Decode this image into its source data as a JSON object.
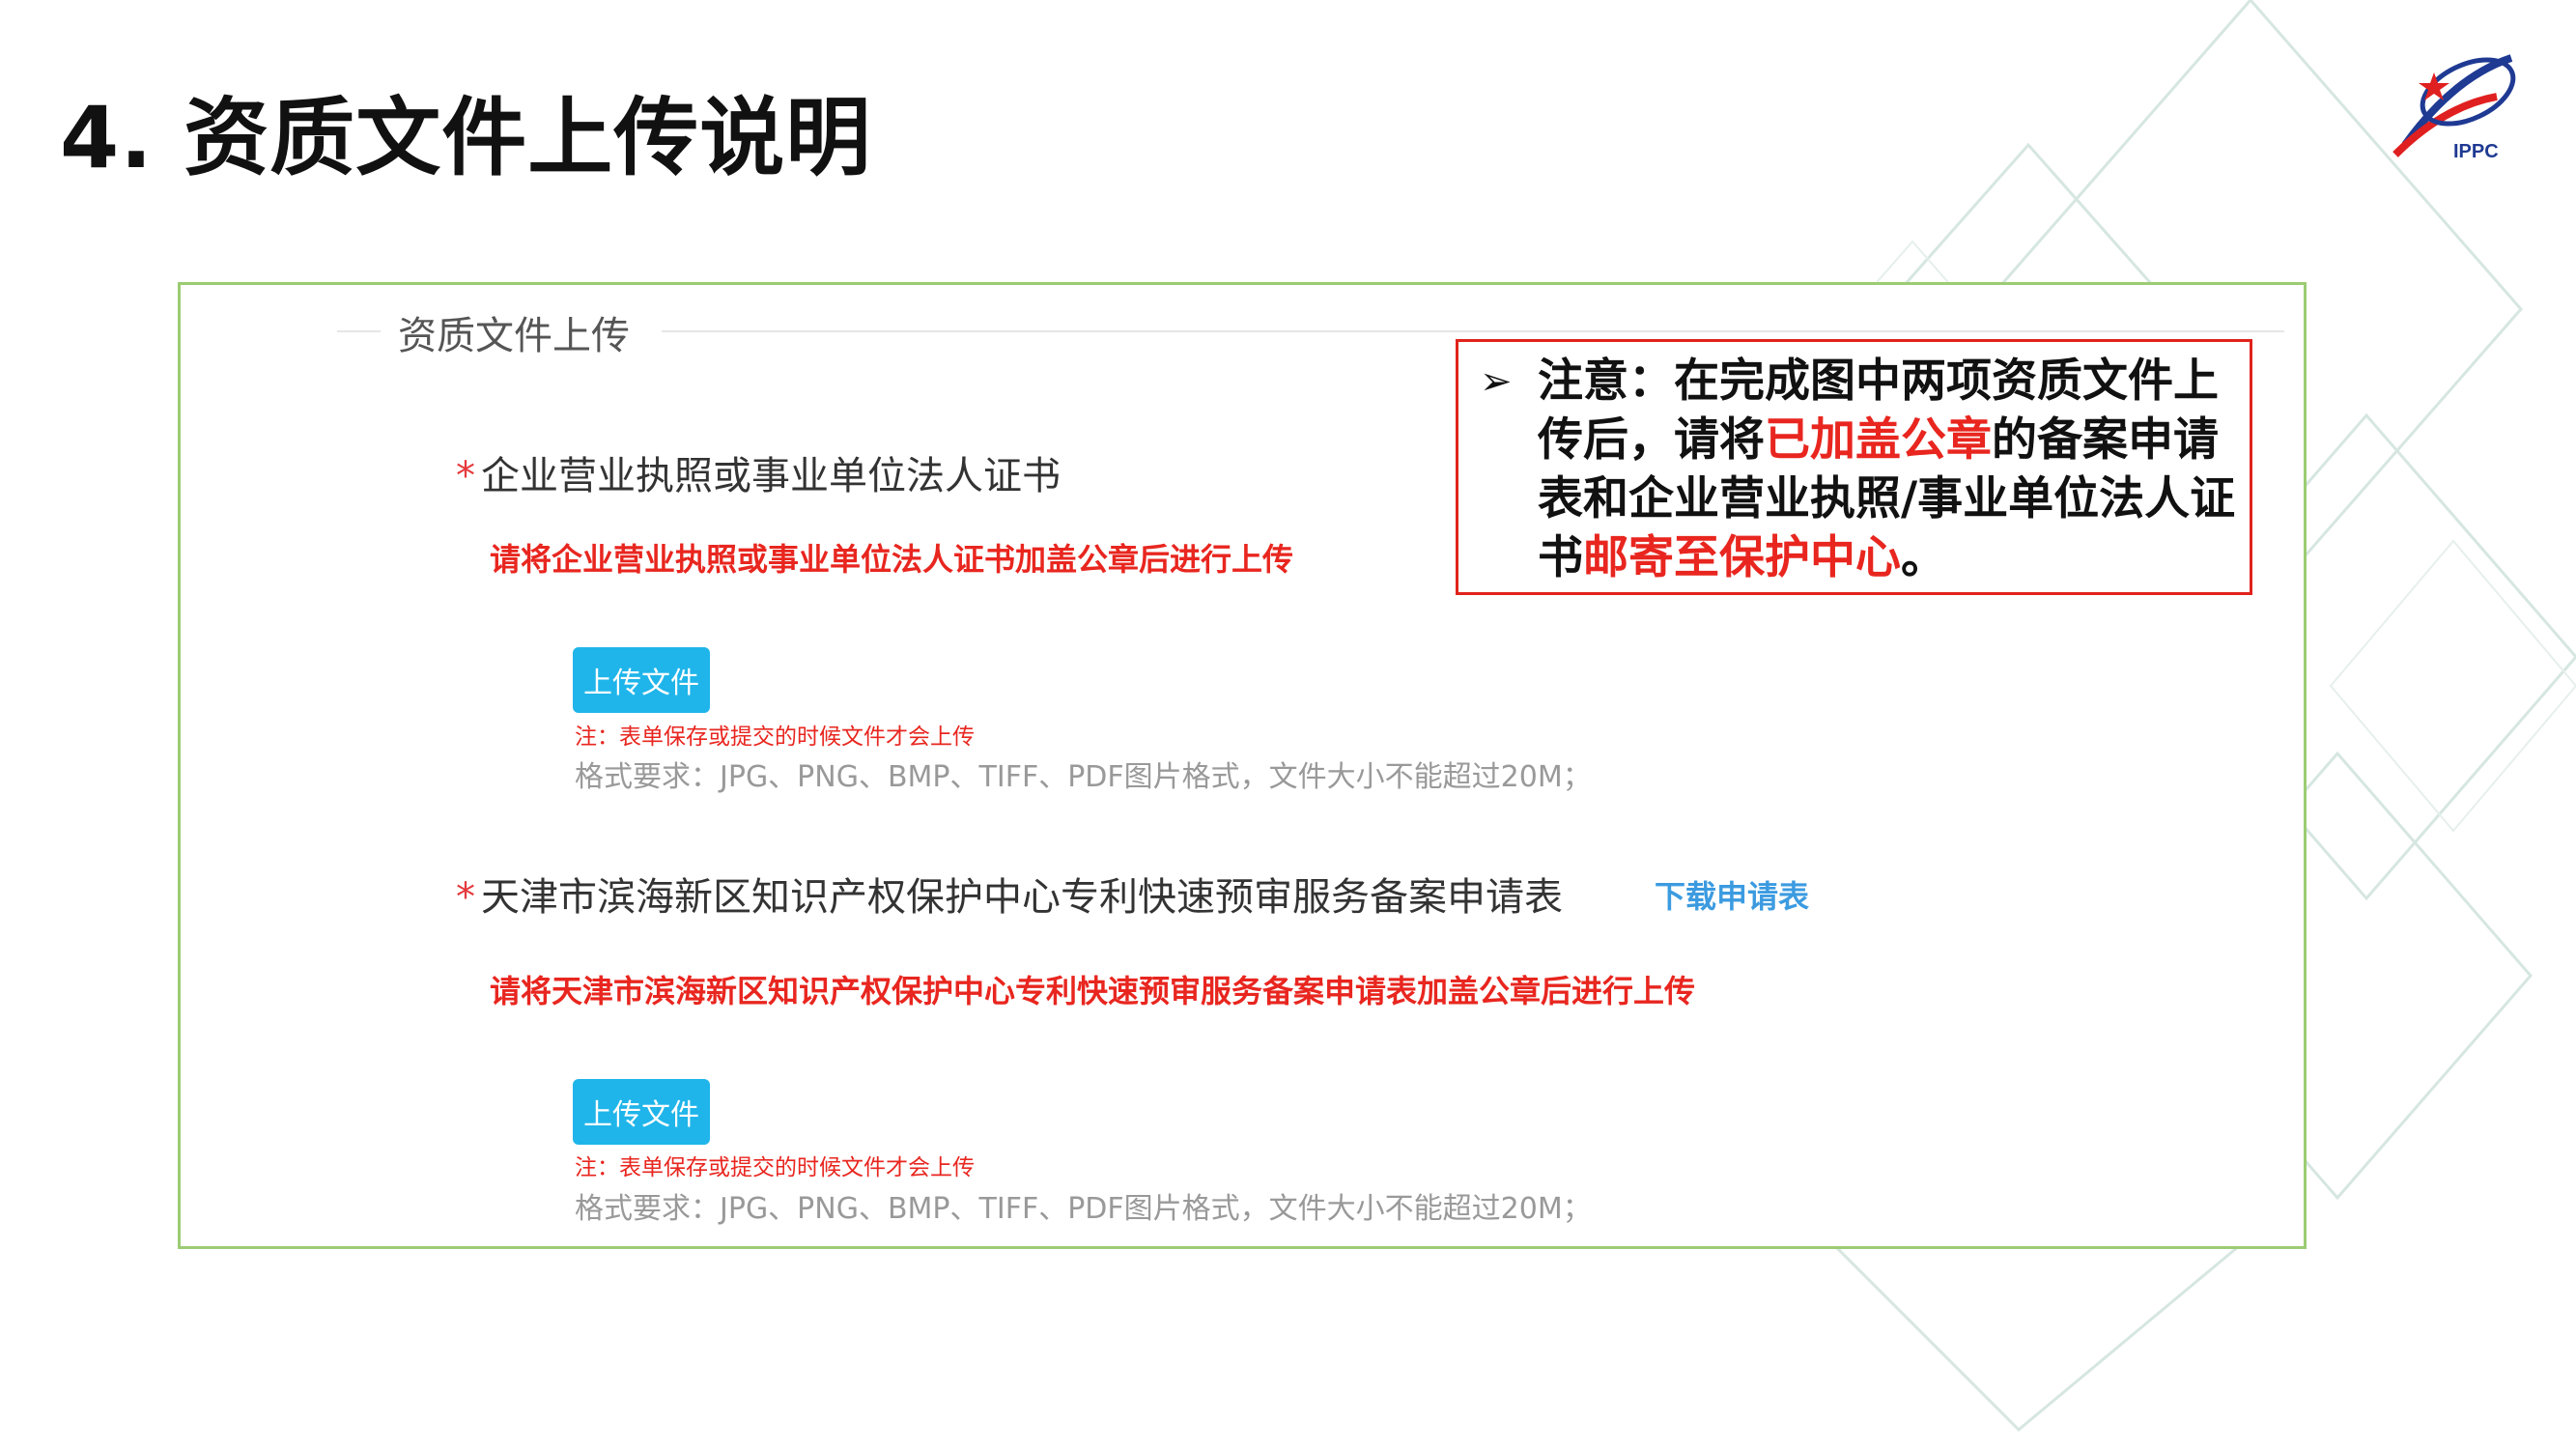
{
  "slide": {
    "title": "4. 资质文件上传说明",
    "logo_text": "IPPC"
  },
  "panel": {
    "legend": "资质文件上传",
    "sections": [
      {
        "required_mark": "*",
        "label": "企业营业执照或事业单位法人证书",
        "red_note": "请将企业营业执照或事业单位法人证书加盖公章后进行上传",
        "upload_button": "上传文件",
        "small_note": "注：表单保存或提交的时候文件才会上传",
        "format_requirement": "格式要求：JPG、PNG、BMP、TIFF、PDF图片格式，文件大小不能超过20M；"
      },
      {
        "required_mark": "*",
        "label": "天津市滨海新区知识产权保护中心专利快速预审服务备案申请表",
        "download_link": "下载申请表",
        "red_note": "请将天津市滨海新区知识产权保护中心专利快速预审服务备案申请表加盖公章后进行上传",
        "upload_button": "上传文件",
        "small_note": "注：表单保存或提交的时候文件才会上传",
        "format_requirement": "格式要求：JPG、PNG、BMP、TIFF、PDF图片格式，文件大小不能超过20M；"
      }
    ]
  },
  "callout": {
    "bullet": "➢",
    "text_part1": "注意：在完成图中两项资质文件上传后，请将",
    "highlight1": "已加盖公章",
    "text_part2": "的备案申请表和企业营业执照/事业单位法人证书",
    "highlight2": "邮寄至保护中心",
    "text_part3": "。"
  },
  "colors": {
    "panel_border": "#9ccc73",
    "button_blue": "#1fb5ea",
    "alert_red": "#e8261f",
    "link_blue": "#3c9be0"
  }
}
